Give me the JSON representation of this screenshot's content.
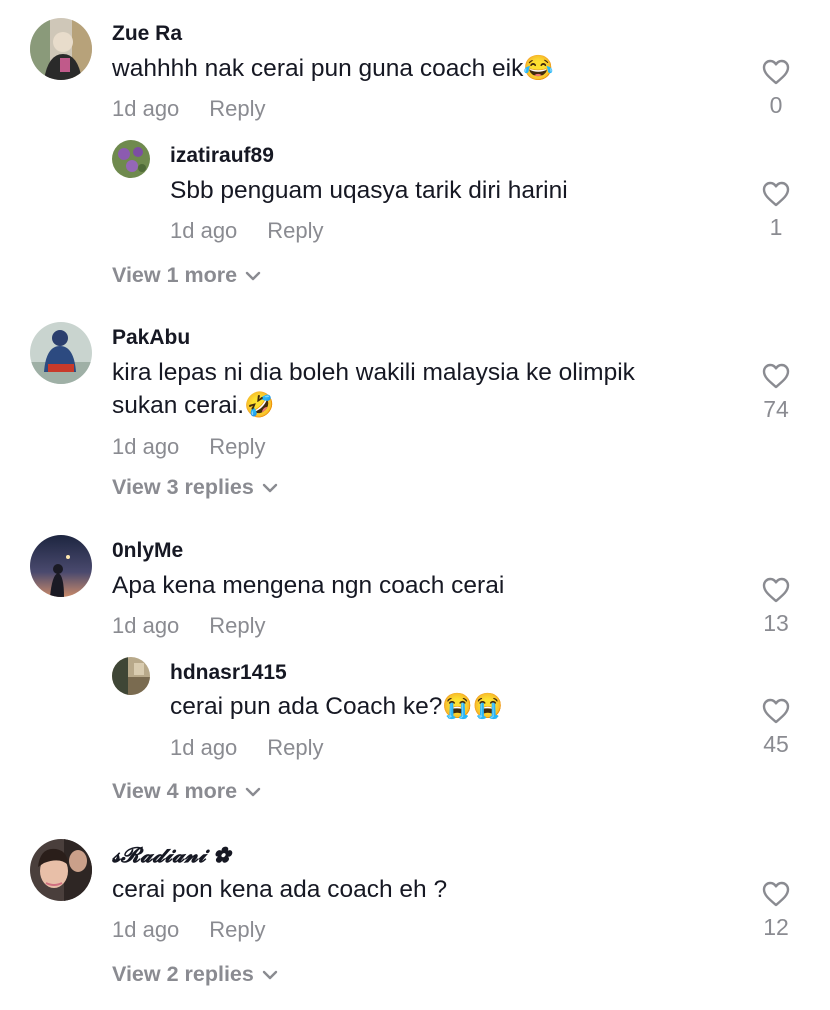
{
  "comments": [
    {
      "username": "Zue Ra",
      "text": "wahhhh nak cerai pun guna coach eik",
      "text_emoji": "😂",
      "time": "1d ago",
      "reply_label": "Reply",
      "likes": "0",
      "replies": [
        {
          "username": "izatirauf89",
          "text": "Sbb penguam uqasya tarik diri harini",
          "time": "1d ago",
          "reply_label": "Reply",
          "likes": "1"
        }
      ],
      "view_more": "View 1 more"
    },
    {
      "username": "PakAbu",
      "text_line1": "kira lepas ni dia boleh wakili malaysia ke olimpik",
      "text_line2": "sukan cerai.",
      "text_emoji": "🤣",
      "time": "1d ago",
      "reply_label": "Reply",
      "likes": "74",
      "view_more": "View 3 replies"
    },
    {
      "username": "0nlyMe",
      "text": "Apa kena mengena ngn coach cerai",
      "time": "1d ago",
      "reply_label": "Reply",
      "likes": "13",
      "replies": [
        {
          "username": "hdnasr1415",
          "text": "cerai pun ada Coach ke?",
          "text_emoji": "😭😭",
          "time": "1d ago",
          "reply_label": "Reply",
          "likes": "45"
        }
      ],
      "view_more": "View 4 more"
    },
    {
      "username": "𝓼𝓡𝓪𝓭𝓲𝓪𝓷𝓲 ✿",
      "text": "cerai pon kena ada coach eh ?",
      "time": "1d ago",
      "reply_label": "Reply",
      "likes": "12",
      "view_more": "View 2 replies"
    }
  ],
  "icons": {
    "like": "heart-outline-icon",
    "expand": "chevron-down-icon"
  },
  "colors": {
    "text": "#161823",
    "secondary": "#8a8b91"
  }
}
